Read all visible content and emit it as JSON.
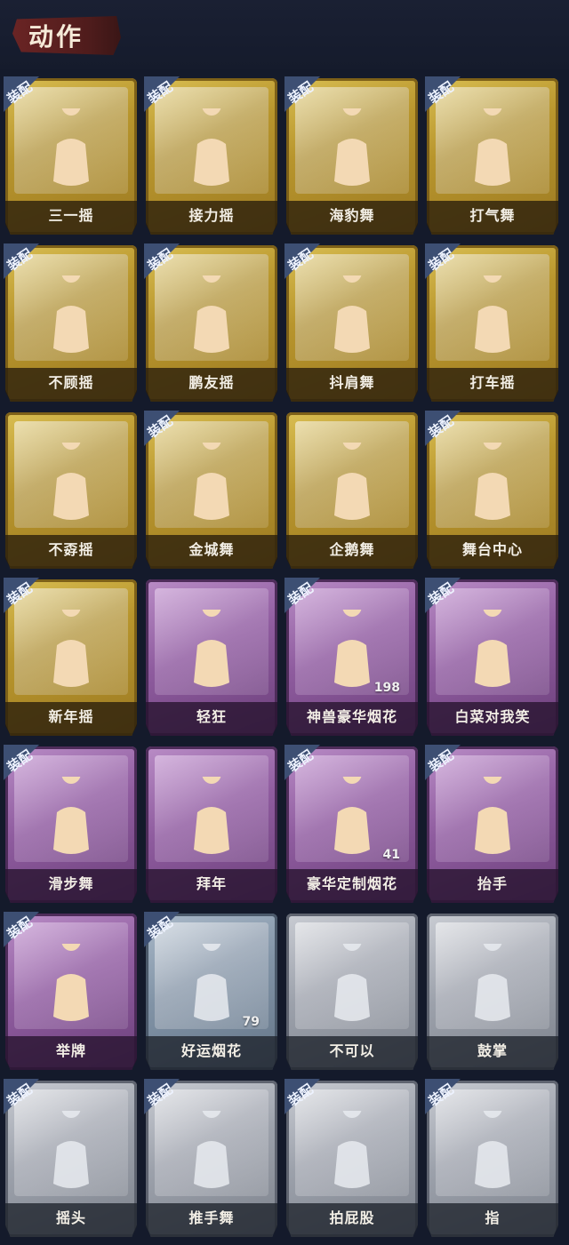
{
  "section_title": "动作",
  "equip_label": "装配",
  "cards": [
    {
      "label": "三一摇",
      "tier": "gold",
      "equipped": true,
      "count": null
    },
    {
      "label": "接力摇",
      "tier": "gold",
      "equipped": true,
      "count": null
    },
    {
      "label": "海豹舞",
      "tier": "gold",
      "equipped": true,
      "count": null
    },
    {
      "label": "打气舞",
      "tier": "gold",
      "equipped": true,
      "count": null
    },
    {
      "label": "不顾摇",
      "tier": "gold",
      "equipped": true,
      "count": null
    },
    {
      "label": "鹏友摇",
      "tier": "gold",
      "equipped": true,
      "count": null
    },
    {
      "label": "抖肩舞",
      "tier": "gold",
      "equipped": true,
      "count": null
    },
    {
      "label": "打车摇",
      "tier": "gold",
      "equipped": true,
      "count": null
    },
    {
      "label": "不孬摇",
      "tier": "gold",
      "equipped": false,
      "count": null
    },
    {
      "label": "金城舞",
      "tier": "gold",
      "equipped": true,
      "count": null
    },
    {
      "label": "企鹅舞",
      "tier": "gold",
      "equipped": false,
      "count": null
    },
    {
      "label": "舞台中心",
      "tier": "gold",
      "equipped": true,
      "count": null
    },
    {
      "label": "新年摇",
      "tier": "gold",
      "equipped": true,
      "count": null
    },
    {
      "label": "轻狂",
      "tier": "purple",
      "equipped": false,
      "count": null
    },
    {
      "label": "神兽豪华烟花",
      "tier": "purple",
      "equipped": true,
      "count": "198"
    },
    {
      "label": "白菜对我笑",
      "tier": "purple",
      "equipped": true,
      "count": null
    },
    {
      "label": "滑步舞",
      "tier": "purple",
      "equipped": true,
      "count": null
    },
    {
      "label": "拜年",
      "tier": "purple",
      "equipped": false,
      "count": null
    },
    {
      "label": "豪华定制烟花",
      "tier": "purple",
      "equipped": true,
      "count": "41"
    },
    {
      "label": "抬手",
      "tier": "purple",
      "equipped": true,
      "count": null
    },
    {
      "label": "举牌",
      "tier": "purple",
      "equipped": true,
      "count": null
    },
    {
      "label": "好运烟花",
      "tier": "bluegray",
      "equipped": true,
      "count": "79"
    },
    {
      "label": "不可以",
      "tier": "silver",
      "equipped": false,
      "count": null
    },
    {
      "label": "鼓掌",
      "tier": "silver",
      "equipped": false,
      "count": null
    },
    {
      "label": "摇头",
      "tier": "silver",
      "equipped": true,
      "count": null
    },
    {
      "label": "推手舞",
      "tier": "silver",
      "equipped": true,
      "count": null
    },
    {
      "label": "拍屁股",
      "tier": "silver",
      "equipped": true,
      "count": null
    },
    {
      "label": "指",
      "tier": "silver",
      "equipped": true,
      "count": null
    }
  ],
  "colors": {
    "background": "#141a2b",
    "gold": "#c9a83a",
    "purple": "#9a68a8",
    "silver": "#a5a9b2",
    "equip_badge": "#3d4f73",
    "title_banner": "#6a2424"
  }
}
